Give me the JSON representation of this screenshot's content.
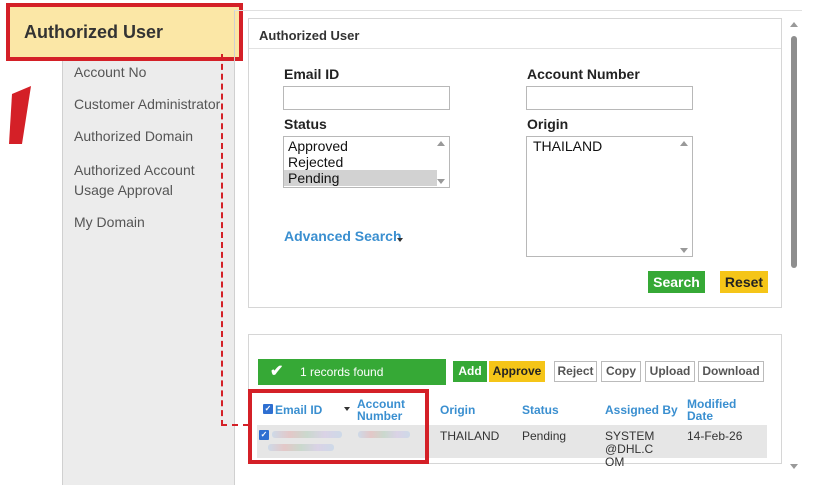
{
  "nav": {
    "active_label": "Authorized User",
    "items": [
      {
        "label": "Account No"
      },
      {
        "label": "Customer Administrator"
      },
      {
        "label": "Authorized Domain"
      },
      {
        "label": "Authorized Account Usage Approval"
      },
      {
        "label": "My Domain"
      }
    ]
  },
  "search": {
    "title": "Authorized User",
    "email_label": "Email ID",
    "email_value": "",
    "account_label": "Account Number",
    "account_value": "",
    "status_label": "Status",
    "status_options": [
      "Approved",
      "Rejected",
      "Pending"
    ],
    "status_selected": "Pending",
    "origin_label": "Origin",
    "origin_options": [
      "THAILAND"
    ],
    "advanced_label": "Advanced Search",
    "search_button": "Search",
    "reset_button": "Reset"
  },
  "results": {
    "records_text": "1 records found",
    "toolbar": [
      "Add",
      "Approve",
      "Reject",
      "Copy",
      "Upload",
      "Download"
    ],
    "columns": [
      "Email ID",
      "Account Number",
      "Origin",
      "Status",
      "Assigned By",
      "Modified Date"
    ],
    "rows": [
      {
        "email": "",
        "account": "",
        "origin": "THAILAND",
        "status": "Pending",
        "assigned_by": "SYSTEM@DHL.COM",
        "modified_date": "14-Feb-26"
      }
    ]
  },
  "colors": {
    "highlight_red": "#d42027",
    "active_nav_bg": "#fbe7a6",
    "green": "#36a936",
    "yellow": "#f5c518",
    "link_blue": "#3a8fd0"
  }
}
